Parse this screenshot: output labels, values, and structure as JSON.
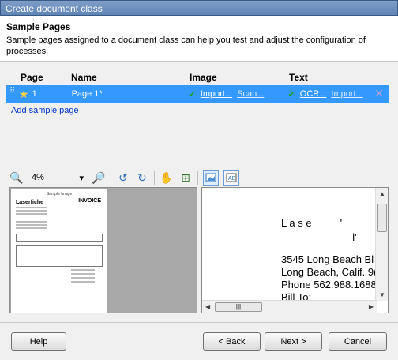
{
  "window": {
    "title": "Create document class"
  },
  "header": {
    "title": "Sample Pages",
    "description": "Sample pages assigned to a document class can help you test and adjust the configuration of processes."
  },
  "grid": {
    "columns": {
      "page": "Page",
      "name": "Name",
      "image": "Image",
      "text": "Text"
    },
    "rows": [
      {
        "page": "1",
        "name": "Page 1*",
        "image_import": "Import...",
        "image_scan": "Scan...",
        "text_ocr": "OCR...",
        "text_import": "Import..."
      }
    ]
  },
  "add_sample_page": "Add sample page",
  "toolbar": {
    "zoom": "4%"
  },
  "preview": {
    "doc_title": "Sample Image",
    "doc_logo": "Laserfiche",
    "doc_invoice": "INVOICE",
    "ocr_line1": "L a s e          '",
    "ocr_line2": "                         l'",
    "ocr_line3": "3545 Long Beach Bl",
    "ocr_line4": "Long Beach, Calif. 9(",
    "ocr_line5": "Phone 562.988.1688",
    "ocr_line6": "Bill To:"
  },
  "footer": {
    "help": "Help",
    "back": "< Back",
    "next": "Next >",
    "cancel": "Cancel"
  }
}
